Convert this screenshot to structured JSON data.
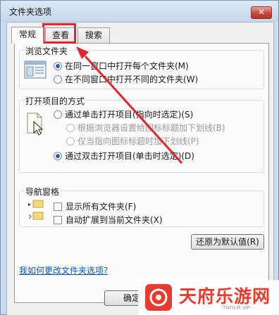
{
  "window": {
    "title": "文件夹选项",
    "close_glyph": "✕"
  },
  "tabs": [
    {
      "label": "常规",
      "active": true
    },
    {
      "label": "查看",
      "active": false
    },
    {
      "label": "搜索",
      "active": false
    }
  ],
  "browse_folders": {
    "legend": "浏览文件夹",
    "options": [
      {
        "label": "在同一窗口中打开每个文件夹(M)",
        "checked": true
      },
      {
        "label": "在不同窗口中打开不同的文件夹(W)",
        "checked": false
      }
    ]
  },
  "click_items": {
    "legend": "打开项目的方式",
    "options": [
      {
        "label": "通过单击打开项目(指向时选定)(S)",
        "checked": false,
        "disabled": false
      },
      {
        "label": "根据浏览器设置给图标标题加下划线(B)",
        "checked": false,
        "disabled": true
      },
      {
        "label": "仅当指向图标标题时加下划线(P)",
        "checked": false,
        "disabled": true
      },
      {
        "label": "通过双击打开项目(单击时选定)(D)",
        "checked": true,
        "disabled": false
      }
    ]
  },
  "nav_pane": {
    "legend": "导航窗格",
    "options": [
      {
        "label": "显示所有文件夹(F)",
        "checked": false
      },
      {
        "label": "自动扩展到当前文件夹(X)",
        "checked": false
      }
    ]
  },
  "restore_button": "还原为默认值(R)",
  "help_link": "我如何更改文件夹选项?",
  "ok_button": "确定",
  "watermark": {
    "brand": "天府乐游网",
    "sub": "TNFILM.VIP"
  },
  "colors": {
    "highlight": "#e0262e",
    "accent_radio": "#2a5fa8",
    "link": "#0b57b4"
  }
}
